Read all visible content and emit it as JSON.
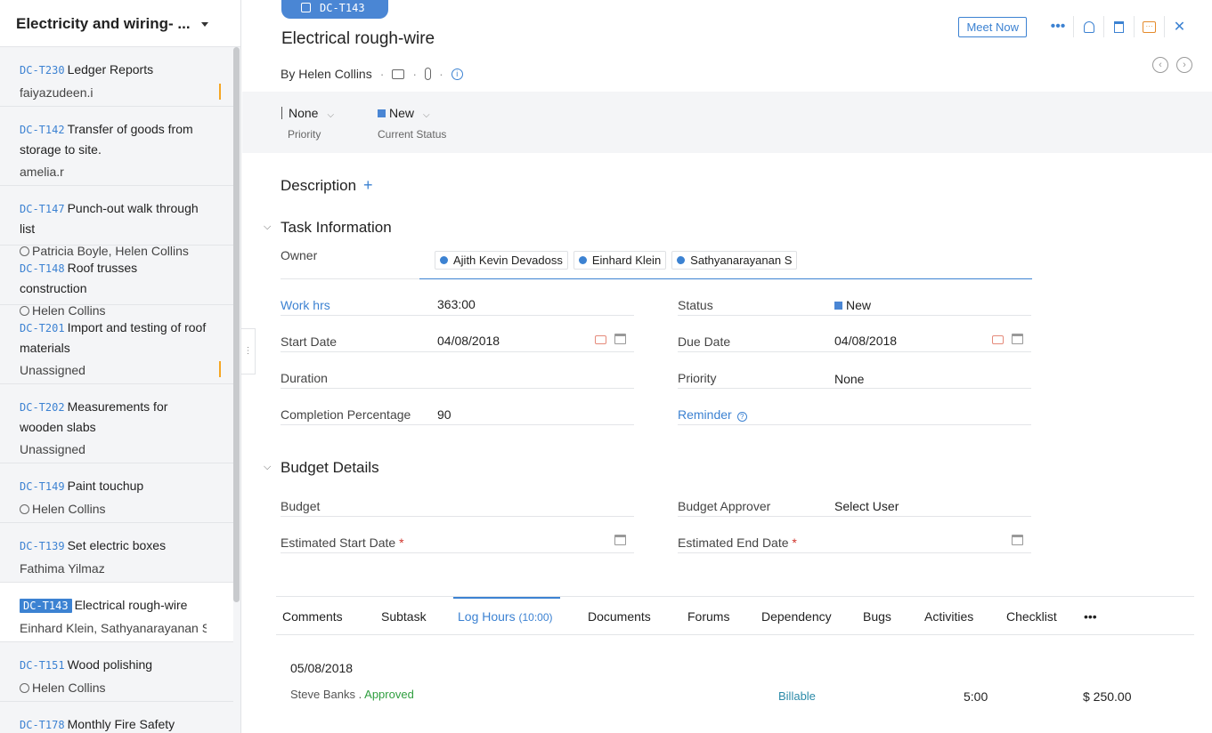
{
  "sidebar": {
    "title": "Electricity and wiring- ...",
    "items": [
      {
        "id": "DC-T230",
        "name": "Ledger Reports",
        "meta": "faiyazudeen.i",
        "clock": false,
        "mark": true,
        "active": false
      },
      {
        "id": "DC-T142",
        "name": "Transfer of goods from storage to site.",
        "meta": "amelia.r",
        "clock": false,
        "mark": false,
        "active": false
      },
      {
        "id": "DC-T147",
        "name": "Punch-out walk through list",
        "meta": "Patricia Boyle, Helen Collins",
        "clock": true,
        "mark": false,
        "active": false
      },
      {
        "id": "DC-T148",
        "name": "Roof trusses construction",
        "meta": "Helen Collins",
        "clock": true,
        "mark": false,
        "active": false
      },
      {
        "id": "DC-T201",
        "name": "Import and testing of roof materials",
        "meta": "Unassigned",
        "clock": false,
        "mark": true,
        "active": false
      },
      {
        "id": "DC-T202",
        "name": "Measurements for wooden slabs",
        "meta": "Unassigned",
        "clock": false,
        "mark": false,
        "active": false
      },
      {
        "id": "DC-T149",
        "name": "Paint touchup",
        "meta": "Helen Collins",
        "clock": true,
        "mark": false,
        "active": false
      },
      {
        "id": "DC-T139",
        "name": "Set electric boxes",
        "meta": "Fathima Yilmaz",
        "clock": false,
        "mark": false,
        "active": false
      },
      {
        "id": "DC-T143",
        "name": "Electrical rough-wire",
        "meta": "Einhard Klein, Sathyanarayanan S",
        "clock": false,
        "mark": false,
        "active": true
      },
      {
        "id": "DC-T151",
        "name": "Wood polishing",
        "meta": "Helen Collins",
        "clock": true,
        "mark": false,
        "active": false
      },
      {
        "id": "DC-T178",
        "name": "Monthly Fire Safety Check",
        "meta": "",
        "clock": false,
        "mark": false,
        "active": false
      }
    ]
  },
  "task": {
    "id": "DC-T143",
    "title": "Electrical rough-wire",
    "byline": "By Helen Collins",
    "meet_now": "Meet Now",
    "priority_value": "None",
    "priority_label": "Priority",
    "status_value": "New",
    "status_label": "Current Status",
    "status_color": "#4a86d4"
  },
  "description": {
    "title": "Description",
    "add": "+"
  },
  "task_info": {
    "title": "Task Information",
    "owner_label": "Owner",
    "owners": [
      "Ajith Kevin Devadoss",
      "Einhard Klein",
      "Sathyanarayanan S"
    ],
    "work_hrs_label": "Work hrs",
    "work_hrs_value": "363:00",
    "status_label": "Status",
    "status_value": "New",
    "start_date_label": "Start Date",
    "start_date_value": "04/08/2018",
    "due_date_label": "Due Date",
    "due_date_value": "04/08/2018",
    "duration_label": "Duration",
    "priority_label": "Priority",
    "priority_value": "None",
    "completion_label": "Completion Percentage",
    "completion_value": "90",
    "reminder_label": "Reminder"
  },
  "budget": {
    "title": "Budget Details",
    "budget_label": "Budget",
    "approver_label": "Budget Approver",
    "approver_value": "Select User",
    "est_start_label": "Estimated Start Date",
    "est_end_label": "Estimated End Date",
    "required_mark": "*"
  },
  "tabs": [
    {
      "label": "Comments",
      "active": false
    },
    {
      "label": "Subtask",
      "active": false
    },
    {
      "label": "Log Hours",
      "count": "(10:00)",
      "active": true
    },
    {
      "label": "Documents",
      "active": false
    },
    {
      "label": "Forums",
      "active": false
    },
    {
      "label": "Dependency",
      "active": false
    },
    {
      "label": "Bugs",
      "active": false
    },
    {
      "label": "Activities",
      "active": false
    },
    {
      "label": "Checklist",
      "active": false
    },
    {
      "label": "•••",
      "active": false
    }
  ],
  "log": {
    "date": "05/08/2018",
    "user": "Steve Banks",
    "separator": ".",
    "approval": "Approved",
    "billing": "Billable",
    "hours": "5:00",
    "amount": "$ 250.00"
  },
  "icons": {
    "more": "•••",
    "close": "✕",
    "prev": "‹",
    "next": "›",
    "chevron": "⌵",
    "collapse": "⌵",
    "info": "i",
    "help": "?"
  }
}
